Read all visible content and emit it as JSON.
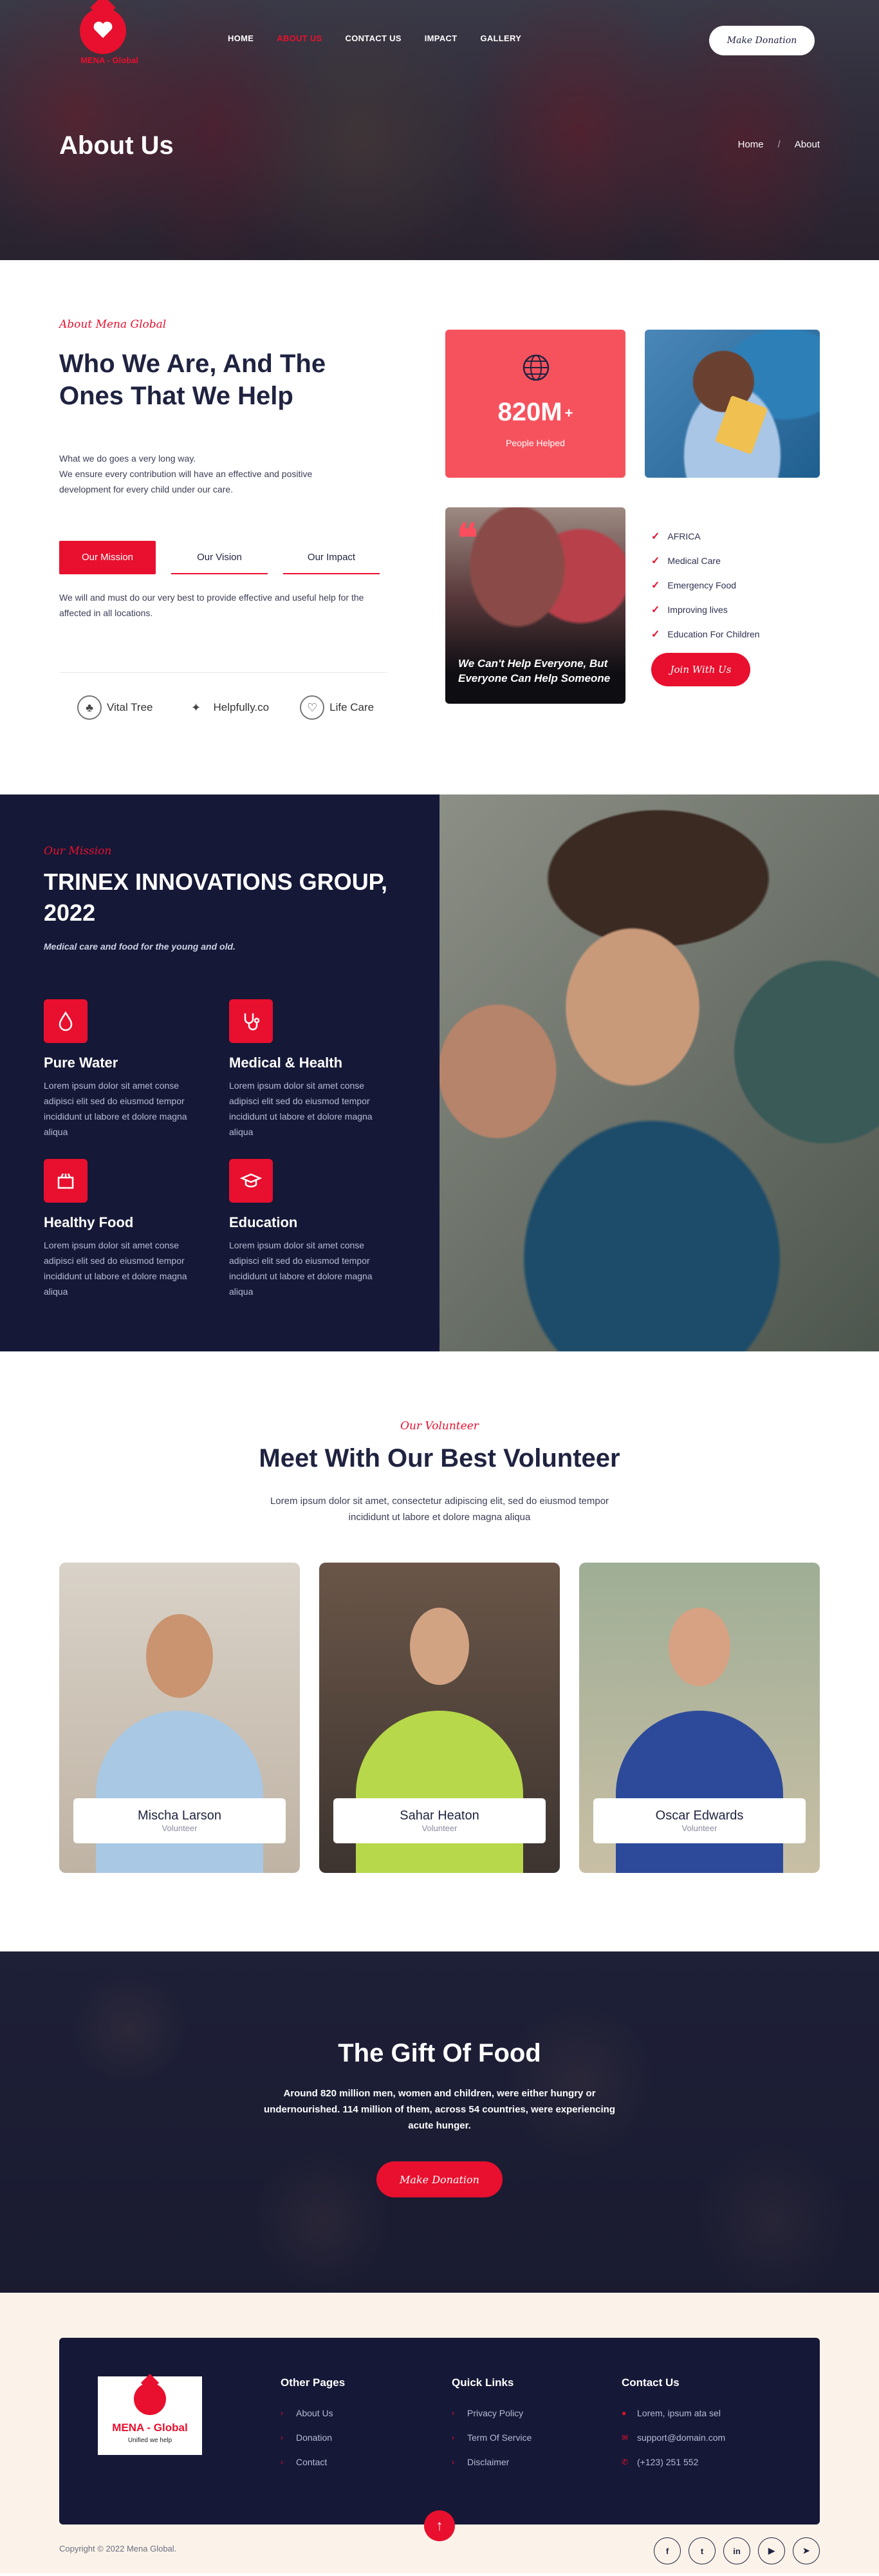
{
  "brand": {
    "name": "MENA - Global",
    "footer_name": "MENA - Global",
    "tagline": "Unified we help",
    "accent": "#e8102e",
    "navy": "#151836"
  },
  "nav": {
    "items": [
      "HOME",
      "ABOUT US",
      "CONTACT US",
      "IMPACT",
      "GALLERY"
    ],
    "active": "ABOUT US"
  },
  "hero": {
    "donate_label": "Make Donation",
    "title": "About Us",
    "breadcrumb": [
      "Home",
      "About"
    ]
  },
  "about": {
    "eyebrow": "About Mena Global",
    "heading": "Who We Are, And The Ones That We Help",
    "intro_1": "What we do goes a very long way.",
    "intro_2": "We ensure every contribution will have an effective and positive development for every child under our care.",
    "tabs": [
      "Our Mission",
      "Our Vision",
      "Our Impact"
    ],
    "tab_text": "We will and must do our very best to provide effective and useful help for the affected in all locations.",
    "partners": [
      "Vital Tree",
      "Helpfully.co",
      "Life Care"
    ],
    "stat_value": "820M",
    "stat_plus": "+",
    "stat_label": "People Helped",
    "quote": "We Can't Help Everyone, But Everyone Can Help Someone",
    "checklist": [
      "AFRICA",
      "Medical Care",
      "Emergency Food",
      "Improving lives",
      "Education For Children"
    ],
    "join_label": "Join With Us"
  },
  "mission": {
    "eyebrow": "Our Mission",
    "heading": "TRINEX INNOVATIONS GROUP, 2022",
    "sub": "Medical care and food for the young and old.",
    "features": [
      {
        "title": "Pure Water",
        "icon": "water-drop-icon",
        "text": "Lorem ipsum dolor sit amet conse adipisci elit sed do eiusmod tempor incididunt ut labore et dolore magna aliqua"
      },
      {
        "title": "Medical & Health",
        "icon": "stethoscope-icon",
        "text": "Lorem ipsum dolor sit amet conse adipisci elit sed do eiusmod tempor incididunt ut labore et dolore magna aliqua"
      },
      {
        "title": "Healthy Food",
        "icon": "food-box-icon",
        "text": "Lorem ipsum dolor sit amet conse adipisci elit sed do eiusmod tempor incididunt ut labore et dolore magna aliqua"
      },
      {
        "title": "Education",
        "icon": "graduation-cap-icon",
        "text": "Lorem ipsum dolor sit amet conse adipisci elit sed do eiusmod tempor incididunt ut labore et dolore magna aliqua"
      }
    ]
  },
  "volunteers": {
    "eyebrow": "Our Volunteer",
    "heading": "Meet With Our Best Volunteer",
    "lead": "Lorem ipsum dolor sit amet, consectetur adipiscing elit, sed do eiusmod tempor incididunt ut labore et dolore magna aliqua",
    "people": [
      {
        "name": "Mischa Larson",
        "role": "Volunteer"
      },
      {
        "name": "Sahar Heaton",
        "role": "Volunteer"
      },
      {
        "name": "Oscar Edwards",
        "role": "Volunteer"
      }
    ]
  },
  "gift": {
    "heading": "The Gift Of Food",
    "text": "Around 820 million men, women and children, were either hungry or undernourished. 114 million of them, across 54 countries, were experiencing acute hunger.",
    "button": "Make Donation"
  },
  "footer": {
    "other_pages": {
      "title": "Other Pages",
      "links": [
        "About Us",
        "Donation",
        "Contact"
      ]
    },
    "quick_links": {
      "title": "Quick Links",
      "links": [
        "Privacy Policy",
        "Term Of Service",
        "Disclaimer"
      ]
    },
    "contact": {
      "title": "Contact Us",
      "address": "Lorem, ipsum ata sel",
      "email": "support@domain.com",
      "phone": "(+123) 251 552"
    },
    "copyright": "Copyright © 2022 Mena Global.",
    "socials": [
      "facebook-icon",
      "twitter-icon",
      "linkedin-icon",
      "youtube-icon",
      "telegram-icon"
    ]
  }
}
